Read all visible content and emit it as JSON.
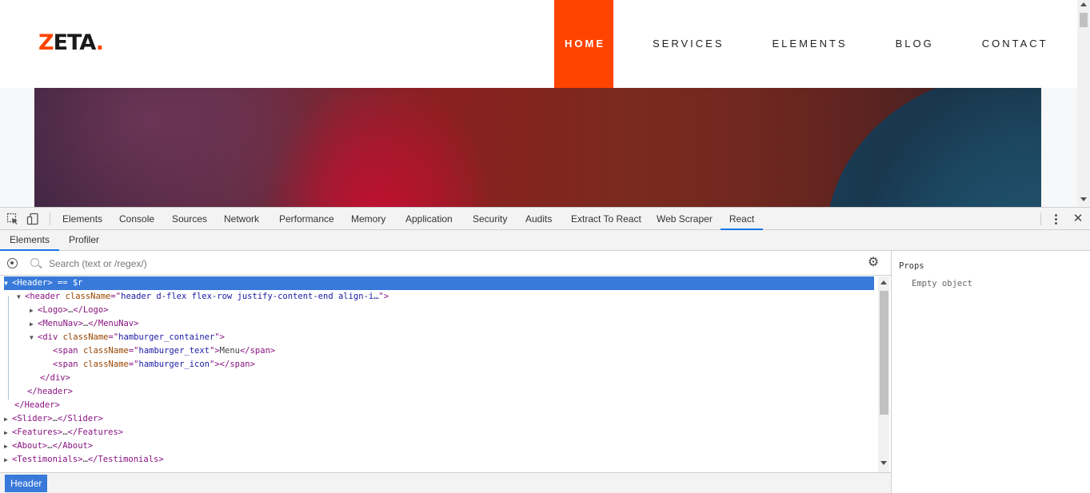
{
  "site": {
    "logo": {
      "z": "Z",
      "rest": "ETA",
      "dot": "."
    },
    "nav": [
      {
        "label": "HOME",
        "active": true
      },
      {
        "label": "SERVICES",
        "active": false
      },
      {
        "label": "ELEMENTS",
        "active": false
      },
      {
        "label": "BLOG",
        "active": false
      },
      {
        "label": "CONTACT",
        "active": false
      }
    ],
    "accent_color": "#ff4400"
  },
  "devtools": {
    "tabs": [
      "Elements",
      "Console",
      "Sources",
      "Network",
      "Performance",
      "Memory",
      "Application",
      "Security",
      "Audits",
      "Extract To React",
      "Web Scraper",
      "React"
    ],
    "active_tab": "React",
    "sub_tabs": [
      "Elements",
      "Profiler"
    ],
    "active_sub_tab": "Elements",
    "search": {
      "placeholder": "Search (text or /regex/)",
      "value": ""
    },
    "tree": {
      "r0": {
        "open": "<Header>",
        "suffix": " == $r"
      },
      "r1": {
        "open": "<header ",
        "attr": "className",
        "eq": "=\"",
        "val": "header d-flex flex-row justify-content-end align-i…",
        "close": "\">"
      },
      "r2": {
        "open": "<Logo>",
        "mid": "…",
        "close": "</Logo>"
      },
      "r3": {
        "open": "<MenuNav>",
        "mid": "…",
        "close": "</MenuNav>"
      },
      "r4": {
        "open": "<div ",
        "attr": "className",
        "eq": "=\"",
        "val": "hamburger_container",
        "close": "\">"
      },
      "r5": {
        "open": "<span ",
        "attr": "className",
        "eq": "=\"",
        "val": "hamburger_text",
        "q": "\">",
        "text": "Menu",
        "close": "</span>"
      },
      "r6": {
        "open": "<span ",
        "attr": "className",
        "eq": "=\"",
        "val": "hamburger_icon",
        "q": "\">",
        "close": "</span>"
      },
      "r7": {
        "close": "</div>"
      },
      "r8": {
        "close": "</header>"
      },
      "r9": {
        "close": "</Header>"
      },
      "r10": {
        "open": "<Slider>",
        "mid": "…",
        "close": "</Slider>"
      },
      "r11": {
        "open": "<Features>",
        "mid": "…",
        "close": "</Features>"
      },
      "r12": {
        "open": "<About>",
        "mid": "…",
        "close": "</About>"
      },
      "r13": {
        "open": "<Testimonials>",
        "mid": "…",
        "close": "</Testimonials>"
      }
    },
    "breadcrumb": "Header",
    "props": {
      "title": "Props",
      "empty": "Empty object"
    },
    "selection_color": "#3879d9"
  }
}
